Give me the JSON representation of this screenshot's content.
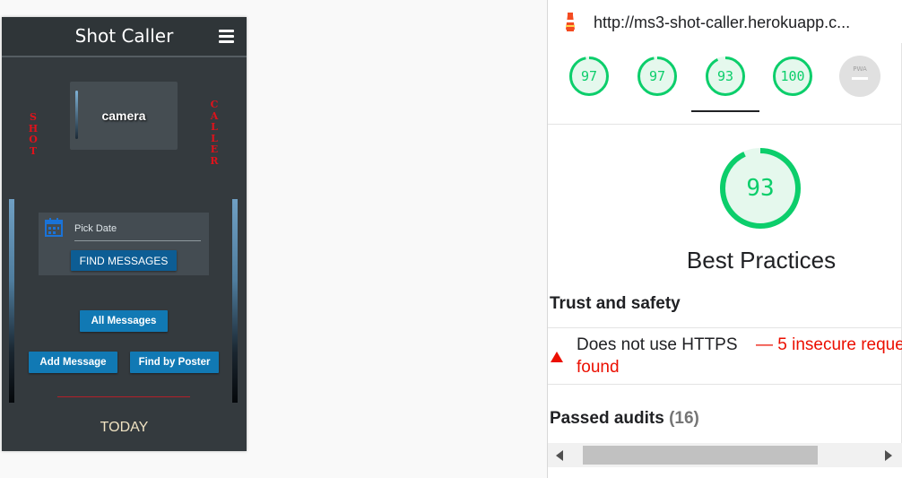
{
  "phone": {
    "brand": "Shot Caller",
    "vertical_left": [
      "S",
      "H",
      "O",
      "T"
    ],
    "vertical_right": [
      "C",
      "A",
      "L",
      "L",
      "E",
      "R"
    ],
    "camera_label": "camera",
    "date_placeholder": "Pick Date",
    "find_messages": "FIND MESSAGES",
    "all_messages": "All Messages",
    "add_message": "Add Message",
    "find_by_poster": "Find by Poster",
    "today": "TODAY",
    "colors": {
      "background": "#343a3e",
      "button": "#1179b4",
      "vertical_text": "#e0121b"
    }
  },
  "lighthouse": {
    "url": "http://ms3-shot-caller.herokuapp.c...",
    "scores": [
      {
        "value": "97",
        "fraction": 0.97
      },
      {
        "value": "97",
        "fraction": 0.97
      },
      {
        "value": "93",
        "fraction": 0.93
      },
      {
        "value": "100",
        "fraction": 1.0
      }
    ],
    "pwa_label": "PWA",
    "selected_score": {
      "value": "93",
      "fraction": 0.93
    },
    "category_title": "Best Practices",
    "section_trust": "Trust and safety",
    "audit_title": "Does not use HTTPS",
    "audit_detail_1": "— 5 insecure reque",
    "audit_detail_2": "found",
    "passed_label": "Passed audits",
    "passed_count": "(16)",
    "colors": {
      "pass": "#0cce6b",
      "fail": "#eb0f00"
    }
  }
}
